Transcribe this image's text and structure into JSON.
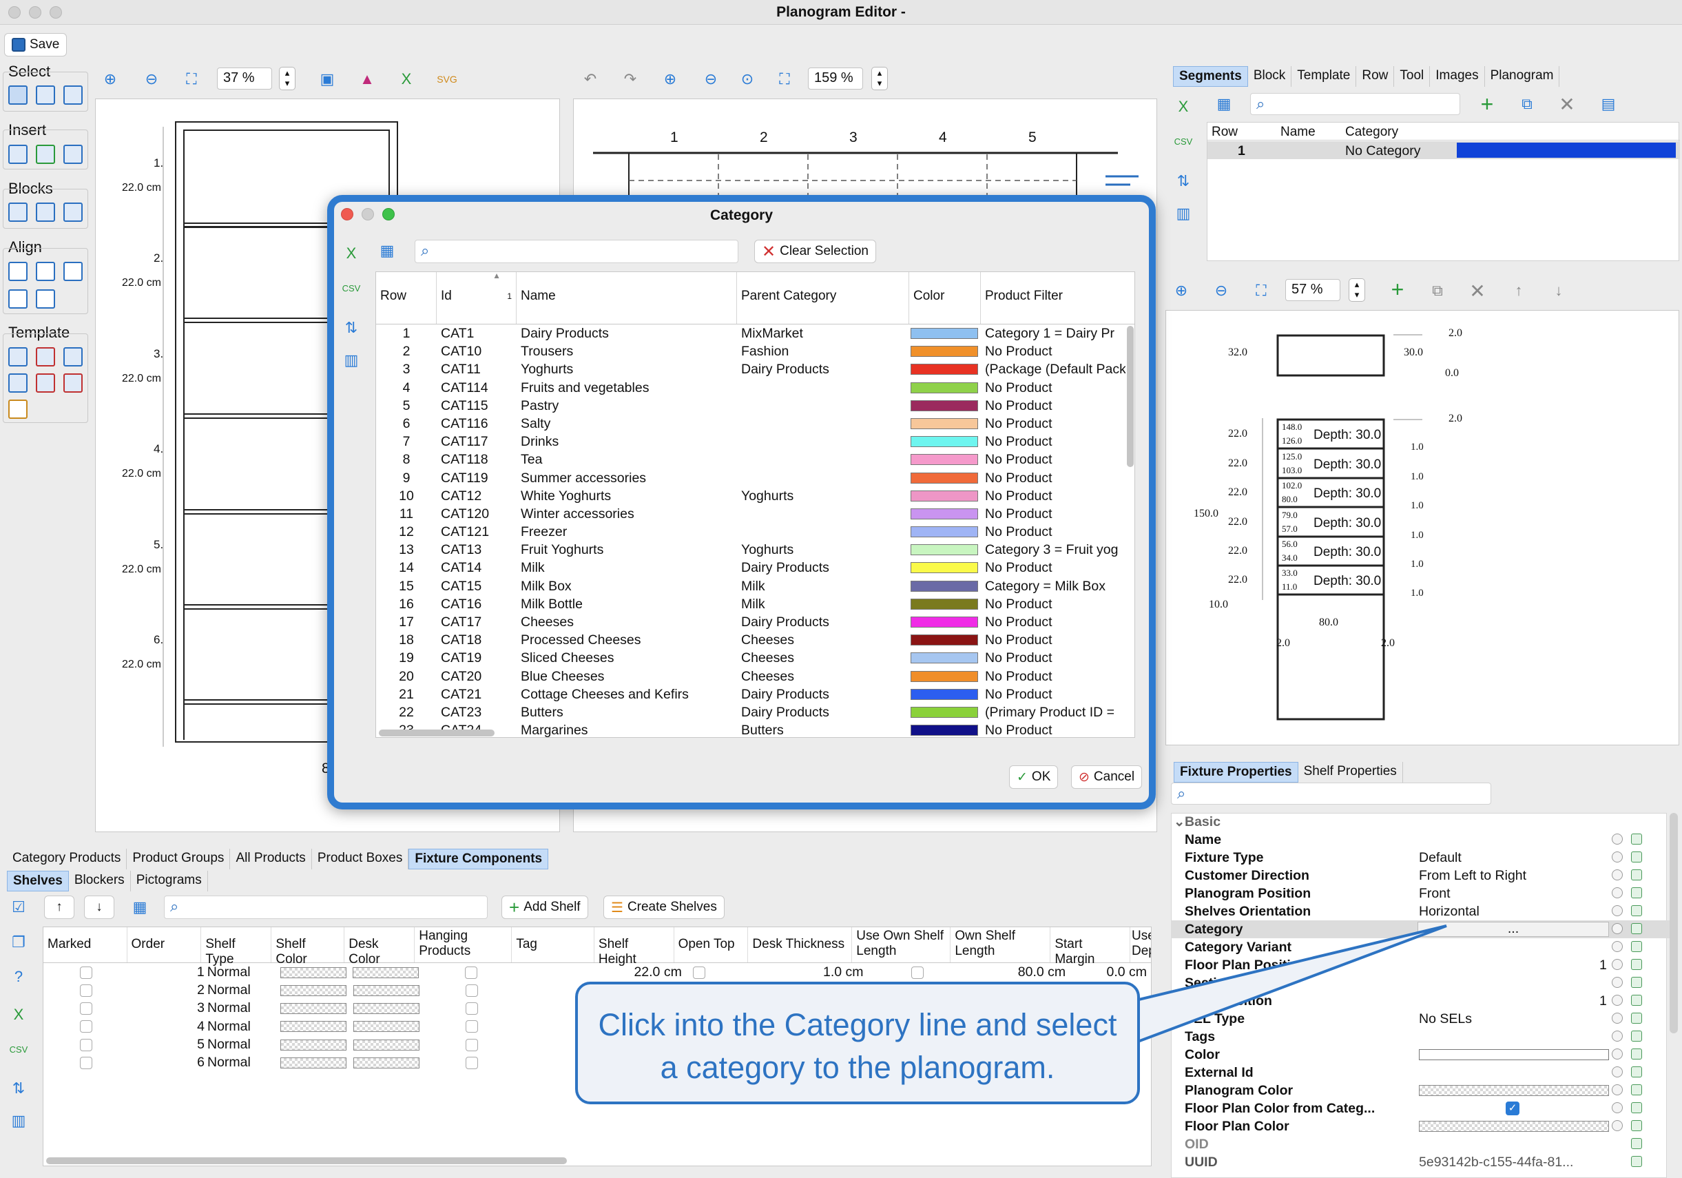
{
  "window": {
    "title": "Planogram Editor -"
  },
  "toolbar": {
    "save_label": "Save"
  },
  "left_panel": {
    "sections": {
      "select": "Select",
      "insert": "Insert",
      "blocks": "Blocks",
      "align": "Align",
      "template": "Template"
    },
    "zoom": "37 %",
    "shelf_labels": [
      "1.",
      "2.",
      "3.",
      "4.",
      "5.",
      "6."
    ],
    "shelf_heights": [
      "22.0 cm",
      "22.0 cm",
      "22.0 cm",
      "22.0 cm",
      "22.0 cm",
      "22.0 cm"
    ],
    "bottom_label": "8"
  },
  "center_panel": {
    "zoom": "159 %",
    "column_numbers": [
      "1",
      "2",
      "3",
      "4",
      "5"
    ]
  },
  "right_top": {
    "tabs": [
      "Segments",
      "Block",
      "Template",
      "Row",
      "Tool",
      "Images",
      "Planogram"
    ],
    "active_tab": "Segments",
    "columns": [
      "Row",
      "Name",
      "Category"
    ],
    "rows": [
      {
        "row": "1",
        "name": "",
        "category": "No Category",
        "color": "#1042d8"
      }
    ]
  },
  "right_mid": {
    "zoom": "57 %",
    "dims": {
      "top_right_a": "2.0",
      "left_a": "32.0",
      "right_a": "30.0",
      "right_b": "0.0",
      "top_right_b": "2.0",
      "height": "150.0",
      "bottom_left": "10.0",
      "width": "80.0",
      "bottom_a": "2.0",
      "bottom_b": "2.0"
    },
    "shelves": [
      {
        "left": "22.0",
        "top": "148.0",
        "bottom": "126.0",
        "depth": "Depth: 30.0",
        "right": "1.0"
      },
      {
        "left": "22.0",
        "top": "125.0",
        "bottom": "103.0",
        "depth": "Depth: 30.0",
        "right": "1.0"
      },
      {
        "left": "22.0",
        "top": "102.0",
        "bottom": "80.0",
        "depth": "Depth: 30.0",
        "right": "1.0"
      },
      {
        "left": "22.0",
        "top": "79.0",
        "bottom": "57.0",
        "depth": "Depth: 30.0",
        "right": "1.0"
      },
      {
        "left": "22.0",
        "top": "56.0",
        "bottom": "34.0",
        "depth": "Depth: 30.0",
        "right": "1.0"
      },
      {
        "left": "22.0",
        "top": "33.0",
        "bottom": "11.0",
        "depth": "Depth: 30.0",
        "right": "1.0"
      }
    ]
  },
  "properties": {
    "tabs": [
      "Fixture Properties",
      "Shelf Properties"
    ],
    "group": "Basic",
    "rows": [
      {
        "key": "Name",
        "value": ""
      },
      {
        "key": "Fixture Type",
        "value": "Default"
      },
      {
        "key": "Customer Direction",
        "value": "From Left to Right"
      },
      {
        "key": "Planogram Position",
        "value": "Front"
      },
      {
        "key": "Shelves Orientation",
        "value": "Horizontal"
      },
      {
        "key": "Category",
        "value": "..."
      },
      {
        "key": "Category Variant",
        "value": ""
      },
      {
        "key": "Floor Plan Positi",
        "value": "1"
      },
      {
        "key": "Secti",
        "value": ""
      },
      {
        "key": "Position",
        "value": "1"
      },
      {
        "key": "SEL Type",
        "value": "No SELs"
      },
      {
        "key": "Tags",
        "value": ""
      },
      {
        "key": "Color",
        "value": ""
      },
      {
        "key": "External Id",
        "value": ""
      },
      {
        "key": "Planogram Color",
        "value": ""
      },
      {
        "key": "Floor Plan Color from Categ...",
        "value": ""
      },
      {
        "key": "Floor Plan Color",
        "value": ""
      },
      {
        "key": "OID",
        "value": ""
      },
      {
        "key": "UUID",
        "value": "5e93142b-c155-44fa-81..."
      }
    ]
  },
  "bottom": {
    "tabs": [
      "Category Products",
      "Product Groups",
      "All Products",
      "Product Boxes",
      "Fixture Components"
    ],
    "active_tab": "Fixture Components",
    "subtabs": [
      "Shelves",
      "Blockers",
      "Pictograms"
    ],
    "active_subtab": "Shelves",
    "add_shelf": "Add Shelf",
    "create_shelves": "Create Shelves",
    "columns": [
      "Marked",
      "Order",
      "Shelf Type",
      "Shelf Color",
      "Desk Color",
      "Hanging Products",
      "Tag",
      "Shelf Height",
      "Open Top",
      "Desk Thickness",
      "Use Own Shelf Length",
      "Own Shelf Length",
      "Start Margin",
      "Use Dep"
    ],
    "rows": [
      {
        "order": "1",
        "type": "Normal",
        "height": "22.0 cm",
        "thickness": "1.0 cm",
        "length": "80.0 cm",
        "margin": "0.0 cm"
      },
      {
        "order": "2",
        "type": "Normal"
      },
      {
        "order": "3",
        "type": "Normal"
      },
      {
        "order": "4",
        "type": "Normal"
      },
      {
        "order": "5",
        "type": "Normal"
      },
      {
        "order": "6",
        "type": "Normal"
      }
    ]
  },
  "dialog": {
    "title": "Category",
    "clear_selection": "Clear Selection",
    "ok": "OK",
    "cancel": "Cancel",
    "sort_indicator": "1",
    "columns": [
      "Row",
      "Id",
      "Name",
      "Parent Category",
      "Color",
      "Product Filter"
    ],
    "rows": [
      {
        "row": "1",
        "id": "CAT1",
        "name": "Dairy Products",
        "parent": "MixMarket",
        "color": "#8ec0f0",
        "filter": "Category 1 = Dairy Pr"
      },
      {
        "row": "2",
        "id": "CAT10",
        "name": "Trousers",
        "parent": "Fashion",
        "color": "#f0902a",
        "filter": "No Product"
      },
      {
        "row": "3",
        "id": "CAT11",
        "name": "Yoghurts",
        "parent": "Dairy Products",
        "color": "#e83223",
        "filter": "(Package (Default Pack"
      },
      {
        "row": "4",
        "id": "CAT114",
        "name": "Fruits and vegetables",
        "parent": "",
        "color": "#8fd14a",
        "filter": "No Product"
      },
      {
        "row": "5",
        "id": "CAT115",
        "name": "Pastry",
        "parent": "",
        "color": "#9b2a5e",
        "filter": "No Product"
      },
      {
        "row": "6",
        "id": "CAT116",
        "name": "Salty",
        "parent": "",
        "color": "#f7c79a",
        "filter": "No Product"
      },
      {
        "row": "7",
        "id": "CAT117",
        "name": "Drinks",
        "parent": "",
        "color": "#6ef5ef",
        "filter": "No Product"
      },
      {
        "row": "8",
        "id": "CAT118",
        "name": "Tea",
        "parent": "",
        "color": "#f59acb",
        "filter": "No Product"
      },
      {
        "row": "9",
        "id": "CAT119",
        "name": "Summer accessories",
        "parent": "",
        "color": "#f06a3a",
        "filter": "No Product"
      },
      {
        "row": "10",
        "id": "CAT12",
        "name": "White Yoghurts",
        "parent": "Yoghurts",
        "color": "#ee96c6",
        "filter": "No Product"
      },
      {
        "row": "11",
        "id": "CAT120",
        "name": "Winter accessories",
        "parent": "",
        "color": "#c994f0",
        "filter": "No Product"
      },
      {
        "row": "12",
        "id": "CAT121",
        "name": "Freezer",
        "parent": "",
        "color": "#9fb4f5",
        "filter": "No Product"
      },
      {
        "row": "13",
        "id": "CAT13",
        "name": "Fruit Yoghurts",
        "parent": "Yoghurts",
        "color": "#c8f5c0",
        "filter": "Category 3 = Fruit yog"
      },
      {
        "row": "14",
        "id": "CAT14",
        "name": "Milk",
        "parent": "Dairy Products",
        "color": "#fafa4a",
        "filter": "No Product"
      },
      {
        "row": "15",
        "id": "CAT15",
        "name": "Milk Box",
        "parent": "Milk",
        "color": "#6a6aa6",
        "filter": "Category = Milk Box"
      },
      {
        "row": "16",
        "id": "CAT16",
        "name": "Milk Bottle",
        "parent": "Milk",
        "color": "#7a7a1e",
        "filter": "No Product"
      },
      {
        "row": "17",
        "id": "CAT17",
        "name": "Cheeses",
        "parent": "Dairy Products",
        "color": "#f02ce6",
        "filter": "No Product"
      },
      {
        "row": "18",
        "id": "CAT18",
        "name": "Processed Cheeses",
        "parent": "Cheeses",
        "color": "#8a1414",
        "filter": "No Product"
      },
      {
        "row": "19",
        "id": "CAT19",
        "name": "Sliced Cheeses",
        "parent": "Cheeses",
        "color": "#a6c6f0",
        "filter": "No Product"
      },
      {
        "row": "20",
        "id": "CAT20",
        "name": "Blue Cheeses",
        "parent": "Cheeses",
        "color": "#f08e2a",
        "filter": "No Product"
      },
      {
        "row": "21",
        "id": "CAT21",
        "name": "Cottage Cheeses and Kefirs",
        "parent": "Dairy Products",
        "color": "#2c5ef0",
        "filter": "No Product"
      },
      {
        "row": "22",
        "id": "CAT23",
        "name": "Butters",
        "parent": "Dairy Products",
        "color": "#8ad13a",
        "filter": "(Primary Product ID ="
      },
      {
        "row": "23",
        "id": "CAT24",
        "name": "Margarines",
        "parent": "Butters",
        "color": "#101088",
        "filter": "No Product"
      }
    ]
  },
  "callout": {
    "line1": "Click into the Category line and select",
    "line2": "a category to the planogram."
  }
}
